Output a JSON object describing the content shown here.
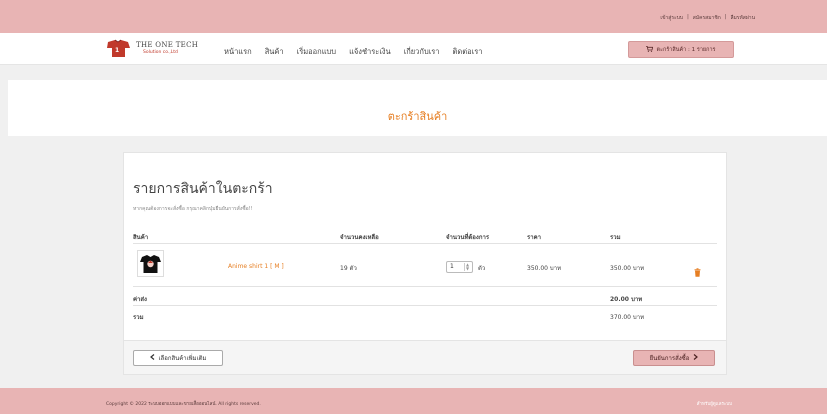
{
  "topbar": {
    "links": [
      "เข้าสู่ระบบ",
      "สมัครสมาชิก",
      "ลืมรหัสผ่าน"
    ],
    "separator": "|"
  },
  "brand": {
    "name": "THE ONE TECH",
    "sub": "Solution co.,Ltd"
  },
  "menu": [
    "หน้าแรก",
    "สินค้า",
    "เริ่มออกแบบ",
    "แจ้งชำระเงิน",
    "เกี่ยวกับเรา",
    "ติดต่อเรา"
  ],
  "cart_button": {
    "label": "ตะกร้าสินค้า : 1 รายการ"
  },
  "banner": {
    "title": "ตะกร้าสินค้า"
  },
  "cart": {
    "heading": "รายการสินค้าในตะกร้า",
    "note": "หากคุณต้องการจะสั่งซื้อ กรุณาคลิกปุ่มยืนยันการสั่งซื้อ!!",
    "headers": {
      "product": "สินค้า",
      "stock": "จำนวนคงเหลือ",
      "qty": "จำนวนที่ต้องการ",
      "price": "ราคา",
      "total": "รวม"
    },
    "item": {
      "name": "Anime shirt 1 [ M ]",
      "stock": "19 ตัว",
      "qty": "1",
      "qty_unit": "ตัว",
      "price": "350.00 บาท",
      "total": "350.00 บาท"
    },
    "shipping": {
      "label": "ค่าส่ง",
      "value": "20.00 บาท"
    },
    "sum": {
      "label": "รวม",
      "value": "370.00 บาท"
    },
    "back_label": "เลือกสินค้าเพิ่มเติม",
    "checkout_label": "ยืนยันการสั่งซื้อ"
  },
  "footer": {
    "copyright": "Copyright © 2022 ระบบออกแบบและขายเสื้อออนไลน์. All rights reserved.",
    "right": "สำหรับผู้ดูแลระบบ"
  },
  "colors": {
    "accent": "#e8b4b4",
    "brand_orange": "#e67e22"
  }
}
